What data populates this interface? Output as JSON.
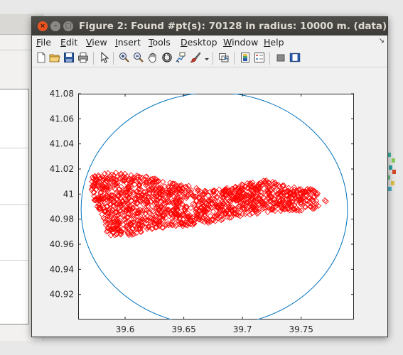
{
  "window": {
    "title": "Figure 2: Found #pt(s): 70128  in radius: 10000 m. (data)",
    "close_glyph": "×",
    "min_glyph": "–",
    "max_glyph": "□"
  },
  "menu": {
    "items": [
      {
        "label": "File",
        "ul": "F",
        "rest": "ile"
      },
      {
        "label": "Edit",
        "ul": "E",
        "rest": "dit"
      },
      {
        "label": "View",
        "ul": "V",
        "rest": "iew"
      },
      {
        "label": "Insert",
        "ul": "I",
        "rest": "nsert"
      },
      {
        "label": "Tools",
        "ul": "T",
        "rest": "ools"
      },
      {
        "label": "Desktop",
        "ul": "D",
        "rest": "esktop"
      },
      {
        "label": "Window",
        "ul": "W",
        "rest": "indow"
      },
      {
        "label": "Help",
        "ul": "H",
        "rest": "elp"
      }
    ],
    "overflow_arrow": "↘"
  },
  "toolbar": {
    "icons": [
      "new-figure-icon",
      "open-file-icon",
      "save-icon",
      "print-icon",
      "edit-plot-icon",
      "zoom-in-icon",
      "zoom-out-icon",
      "pan-icon",
      "rotate-3d-icon",
      "data-cursor-icon",
      "brush-icon",
      "link-plot-icon",
      "colorbar-icon",
      "legend-icon",
      "hide-plot-tools-icon",
      "show-plot-tools-icon"
    ]
  },
  "colors": {
    "data_marker": "#ff0000",
    "circle": "#0072bd",
    "axis": "#262626"
  },
  "chart_data": {
    "type": "scatter",
    "title": "",
    "xlabel": "",
    "ylabel": "",
    "xlim": [
      39.56,
      39.795
    ],
    "ylim": [
      40.9,
      41.08
    ],
    "x_ticks": [
      "39.6",
      "39.65",
      "39.7",
      "39.75"
    ],
    "y_ticks": [
      "41.08",
      "41.06",
      "41.04",
      "41.02",
      "41",
      "40.98",
      "40.96",
      "40.94",
      "40.92"
    ],
    "grid": false,
    "series": [
      {
        "marker": "diamond",
        "color": "#ff0000",
        "approx_outline": [
          [
            39.572,
            41.015
          ],
          [
            39.59,
            41.018
          ],
          [
            39.62,
            41.014
          ],
          [
            39.65,
            41.008
          ],
          [
            39.67,
            41.002
          ],
          [
            39.69,
            41.006
          ],
          [
            39.72,
            41.012
          ],
          [
            39.74,
            41.006
          ],
          [
            39.763,
            41.004
          ],
          [
            39.772,
            40.994
          ],
          [
            39.76,
            40.987
          ],
          [
            39.73,
            40.986
          ],
          [
            39.7,
            40.982
          ],
          [
            39.68,
            40.978
          ],
          [
            39.66,
            40.975
          ],
          [
            39.64,
            40.974
          ],
          [
            39.62,
            40.97
          ],
          [
            39.6,
            40.966
          ],
          [
            39.585,
            40.967
          ],
          [
            39.582,
            40.98
          ],
          [
            39.575,
            40.99
          ],
          [
            39.571,
            41.003
          ]
        ]
      },
      {
        "name": "",
        "type": "circle",
        "color": "#0072bd",
        "center": [
          39.676,
          40.988
        ],
        "radius_x": 0.1135,
        "radius_y": 0.093
      }
    ]
  }
}
